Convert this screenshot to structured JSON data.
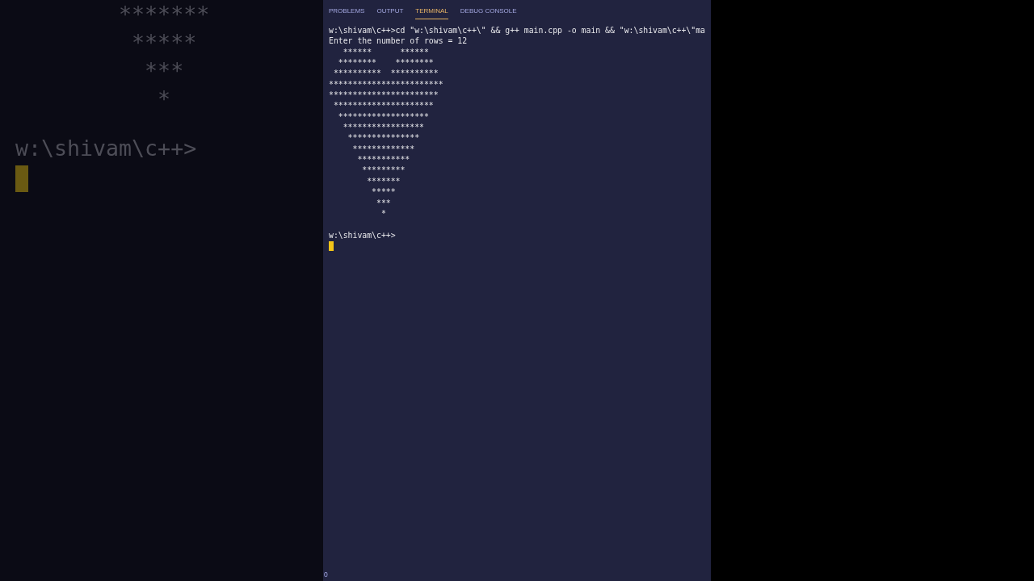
{
  "backdrop": {
    "pattern": "        *******\n         *****\n          ***\n           *",
    "prompt": "w:\\shivam\\c++>"
  },
  "panel": {
    "tabs": [
      {
        "label": "PROBLEMS",
        "selected": false
      },
      {
        "label": "OUTPUT",
        "selected": false
      },
      {
        "label": "TERMINAL",
        "selected": true
      },
      {
        "label": "DEBUG CONSOLE",
        "selected": false
      }
    ]
  },
  "terminal": {
    "lines": [
      "w:\\shivam\\c++>cd \"w:\\shivam\\c++\\\" && g++ main.cpp -o main && \"w:\\shivam\\c++\\\"ma",
      "Enter the number of rows = 12"
    ],
    "pattern": "   ******      ******\n  ********    ********\n **********  **********\n************************\n***********************\n *********************\n  *******************\n   *****************\n    ***************\n     *************\n      ***********\n       *********\n        *******\n         *****\n          ***\n           *",
    "prompt": "w:\\shivam\\c++>"
  },
  "status_bar": {
    "text": "0"
  }
}
